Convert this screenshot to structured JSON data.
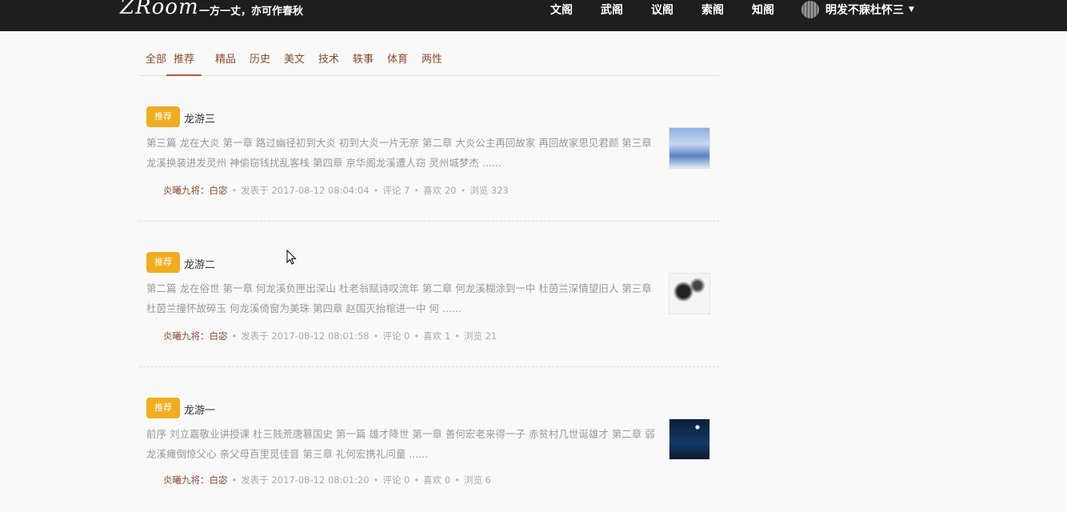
{
  "header": {
    "logo": "ZRoom",
    "slogan": "一方一丈，亦可作春秋",
    "nav": [
      "文阁",
      "武阁",
      "议阁",
      "索阁",
      "知阁"
    ],
    "username": "明发不寐杜怀三"
  },
  "tabs": [
    "全部",
    "推荐",
    "精品",
    "历史",
    "美文",
    "技术",
    "轶事",
    "体育",
    "两性"
  ],
  "active_tab": "推荐",
  "articles": [
    {
      "badge": "推荐",
      "title": "龙游三",
      "summary": "第三篇 龙在大炎 第一章 路过幽径初到大炎 初到大炎一片无奈 第二章 大炎公主再回故家 再回故家思见君颜 第三章 龙溪换装进发灵州 神偷窃钱扰乱客栈 第四章 京华阁龙溪遭人窃 灵州城梦杰 ......",
      "author": "炎曦九将：白宓",
      "date": "发表于 2017-08-12 08:04:04",
      "comments": "评论 7",
      "likes": "喜欢 20",
      "views": "浏览 323"
    },
    {
      "badge": "推荐",
      "title": "龙游二",
      "summary": "第二篇 龙在俗世 第一章 何龙溪负匣出深山 杜老翁赋诗叹流年 第二章 何龙溪糊涂到一中 杜茵兰深情望旧人 第三章 杜茵兰撞怀故碎玉 何龙溪倚窗为美珠 第四章 赵国灭抬棺进一中 何 ......",
      "author": "炎曦九将：白宓",
      "date": "发表于 2017-08-12 08:01:58",
      "comments": "评论 0",
      "likes": "喜欢 1",
      "views": "浏览 21"
    },
    {
      "badge": "推荐",
      "title": "龙游一",
      "summary": "前序 刘立嘉敬业讲授课 杜三贱荒唐篡国史 第一篇 雄才降世 第一章 善何宏老来得一子 赤贫村几世诞雄才 第二章 弱龙溪瘫倒惊父心 亲父母百里觅佳音 第三章 礼何宏携礼问童 ......",
      "author": "炎曦九将：白宓",
      "date": "发表于 2017-08-12 08:01:20",
      "comments": "评论 0",
      "likes": "喜欢 0",
      "views": "浏览 6"
    }
  ]
}
